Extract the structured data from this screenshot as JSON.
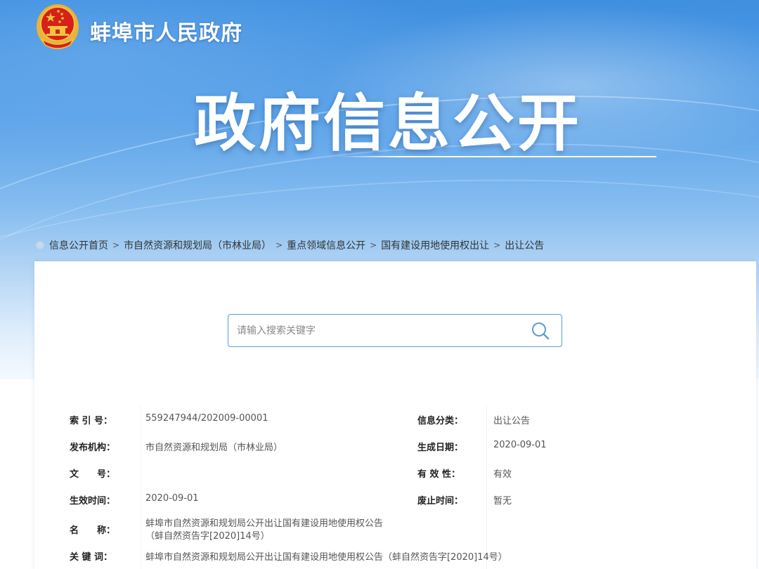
{
  "header": {
    "site_name": "蚌埠市人民政府",
    "hero_title": "政府信息公开",
    "emblem_icon": "national-emblem-icon",
    "colors": {
      "banner_top": "#3f8fe0",
      "banner_bottom": "#f4f9ff",
      "emblem_red": "#d7201a",
      "emblem_gold": "#f2c33d"
    }
  },
  "breadcrumb": {
    "items": [
      "信息公开首页",
      "市自然资源和规划局（市林业局）",
      "重点领域信息公开",
      "国有建设用地使用权出让",
      "出让公告"
    ],
    "separator": ">"
  },
  "search": {
    "placeholder": "请输入搜索关键字",
    "value": "",
    "icon": "search-icon",
    "accent_color": "#5b9bd5"
  },
  "meta": {
    "index_no": {
      "label": "索 引 号：",
      "value": "559247944/202009-00001"
    },
    "category": {
      "label": "信息分类：",
      "value": "出让公告"
    },
    "publisher": {
      "label": "发布机构：",
      "value": "市自然资源和规划局（市林业局）"
    },
    "created_date": {
      "label": "生成日期：",
      "value": "2020-09-01"
    },
    "doc_no": {
      "label": "文　　号：",
      "value": ""
    },
    "validity": {
      "label": "有 效 性：",
      "value": "有效"
    },
    "effective_date": {
      "label": "生效时间：",
      "value": "2020-09-01"
    },
    "expiry_date": {
      "label": "废止时间：",
      "value": "暂无"
    },
    "name": {
      "label": "名　　称：",
      "line1": "蚌埠市自然资源和规划局公开出让国有建设用地使用权公告",
      "line2": "（蚌自然资告字[2020]14号）"
    },
    "keywords": {
      "label": "关 键 词：",
      "value": "蚌埠市自然资源和规划局公开出让国有建设用地使用权公告（蚌自然资告字[2020]14号）"
    }
  }
}
